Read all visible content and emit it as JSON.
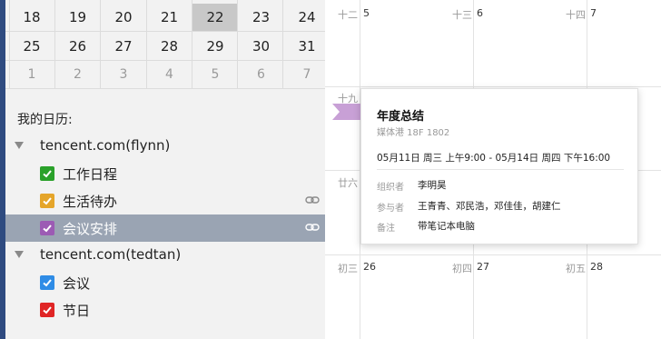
{
  "mini_calendar": {
    "rows": [
      [
        "18",
        "19",
        "20",
        "21",
        "22",
        "23",
        "24"
      ],
      [
        "25",
        "26",
        "27",
        "28",
        "29",
        "30",
        "31"
      ],
      [
        "1",
        "2",
        "3",
        "4",
        "5",
        "6",
        "7"
      ]
    ],
    "selected_day": "22"
  },
  "sidebar": {
    "heading": "我的日历:",
    "accounts": [
      {
        "label": "tencent.com(flynn)",
        "calendars": [
          {
            "label": "工作日程",
            "color": "#2aa12a",
            "linked": false
          },
          {
            "label": "生活待办",
            "color": "#e5a52a",
            "linked": true
          },
          {
            "label": "会议安排",
            "color": "#9c5bb4",
            "linked": true,
            "selected": true
          }
        ]
      },
      {
        "label": "tencent.com(tedtan)",
        "calendars": [
          {
            "label": "会议",
            "color": "#2f8ce6",
            "linked": false
          },
          {
            "label": "节日",
            "color": "#e02626",
            "linked": false
          }
        ]
      }
    ]
  },
  "month_view": {
    "week_labels": [
      "十二",
      "十九",
      "廿六"
    ],
    "cells": [
      {
        "lunar": "十二",
        "day": "5"
      },
      {
        "lunar": "十三",
        "day": "6"
      },
      {
        "lunar": "十四",
        "day": "7"
      },
      {
        "lunar": "初三",
        "day": "26"
      },
      {
        "lunar": "初四",
        "day": "27"
      },
      {
        "lunar": "初五",
        "day": "28"
      }
    ],
    "event_color": "#c8a0d6"
  },
  "event_popup": {
    "title": "年度总结",
    "location": "媒体港 18F 1802",
    "time": "05月11日  周三  上午9:00 - 05月14日  周四  下午16:00",
    "fields": [
      {
        "key": "组织者",
        "value": "李明昊"
      },
      {
        "key": "参与者",
        "value": "王青青、邓民浩，邓佳佳，胡建仁"
      },
      {
        "key": "备注",
        "value": "带笔记本电脑"
      }
    ]
  }
}
